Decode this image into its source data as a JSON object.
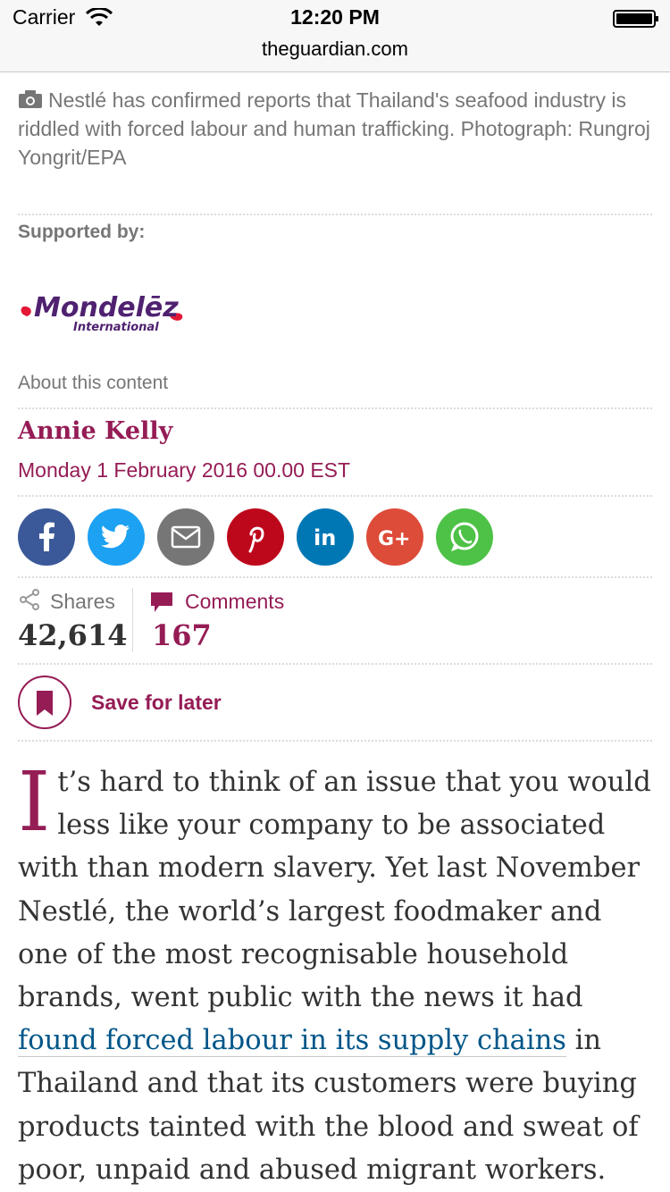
{
  "statusbar": {
    "carrier": "Carrier",
    "time": "12:20 PM",
    "url": "theguardian.com"
  },
  "caption": "Nestlé has confirmed reports that Thailand's seafood industry is riddled with forced labour and human trafficking. Photograph: Rungroj Yongrit/EPA",
  "sponsor": {
    "supported_by": "Supported by:",
    "logo_name": "Mondelēz",
    "logo_sub": "International",
    "about": "About this content"
  },
  "byline": {
    "author": "Annie Kelly",
    "date": "Monday 1 February 2016 00.00 EST"
  },
  "share_buttons": [
    {
      "name": "facebook",
      "color": "#3b5998"
    },
    {
      "name": "twitter",
      "color": "#1da1f2"
    },
    {
      "name": "email",
      "color": "#767676"
    },
    {
      "name": "pinterest",
      "color": "#bd081c"
    },
    {
      "name": "linkedin",
      "color": "#0077b5"
    },
    {
      "name": "google-plus",
      "color": "#dd4b39"
    },
    {
      "name": "whatsapp",
      "color": "#4dc247"
    }
  ],
  "stats": {
    "shares_label": "Shares",
    "shares_count": "42,614",
    "comments_label": "Comments",
    "comments_count": "167"
  },
  "save_label": "Save for later",
  "article": {
    "dropcap": "I",
    "part1": "t’s hard to think of an issue that you would less like your company to be associated with than modern slavery. Yet last November Nestlé, the world’s largest foodmaker and one of the most recognisable household brands, went public with the news it had ",
    "link": "found forced labour in its supply chains",
    "part2": " in Thailand and that its customers were buying products tainted with the blood and sweat of poor, unpaid and abused migrant workers."
  },
  "colors": {
    "accent": "#951c55",
    "link": "#005689",
    "meta_text": "#767676"
  }
}
